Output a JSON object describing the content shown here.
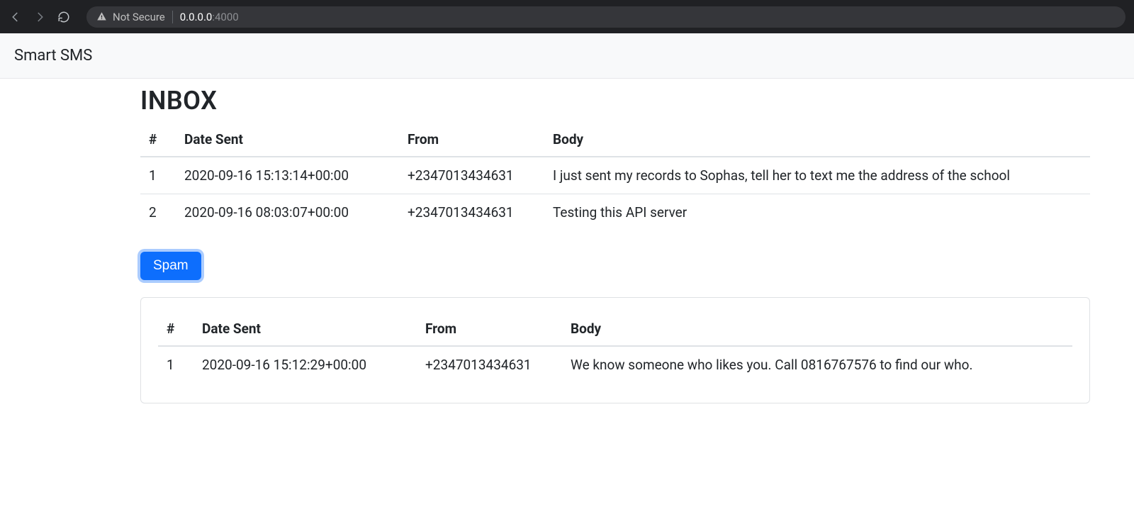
{
  "browser": {
    "not_secure_label": "Not Secure",
    "url_host": "0.0.0.0",
    "url_port": ":4000"
  },
  "navbar": {
    "brand": "Smart SMS"
  },
  "page": {
    "title": "INBOX"
  },
  "inbox_table": {
    "headers": {
      "index": "#",
      "date": "Date Sent",
      "from": "From",
      "body": "Body"
    },
    "rows": [
      {
        "index": "1",
        "date": "2020-09-16 15:13:14+00:00",
        "from": "+2347013434631",
        "body": "I just sent my records to Sophas, tell her to text me the address of the school"
      },
      {
        "index": "2",
        "date": "2020-09-16 08:03:07+00:00",
        "from": "+2347013434631",
        "body": "Testing this API server"
      }
    ]
  },
  "spam_button": {
    "label": "Spam"
  },
  "spam_table": {
    "headers": {
      "index": "#",
      "date": "Date Sent",
      "from": "From",
      "body": "Body"
    },
    "rows": [
      {
        "index": "1",
        "date": "2020-09-16 15:12:29+00:00",
        "from": "+2347013434631",
        "body": "We know someone who likes you. Call 0816767576 to find our who."
      }
    ]
  }
}
